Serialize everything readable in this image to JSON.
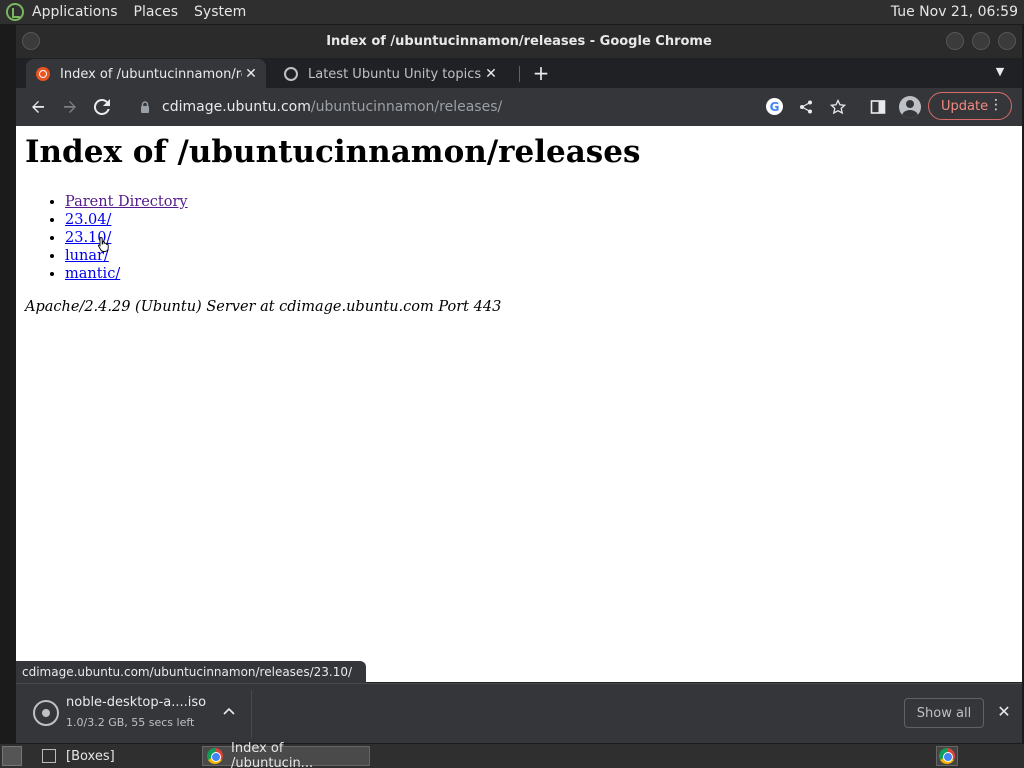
{
  "top_panel": {
    "menus": [
      "Applications",
      "Places",
      "System"
    ],
    "clock": "Tue Nov 21, 06:59"
  },
  "window": {
    "title": "Index of /ubuntucinnamon/releases - Google Chrome"
  },
  "tabs": [
    {
      "title": "Index of /ubuntucinnamon/releases",
      "active": true,
      "favicon": "ubuntu-icon"
    },
    {
      "title": "Latest Ubuntu Unity topics - Ubuntu Community Hub",
      "active": false,
      "favicon": "globe-icon"
    }
  ],
  "toolbar": {
    "url_host": "cdimage.ubuntu.com",
    "url_path": "/ubuntucinnamon/releases/",
    "update_label": "Update"
  },
  "page": {
    "heading": "Index of /ubuntucinnamon/releases",
    "links": [
      "Parent Directory",
      "23.04/",
      "23.10/",
      "lunar/",
      "mantic/"
    ],
    "server_signature": "Apache/2.4.29 (Ubuntu) Server at cdimage.ubuntu.com Port 443"
  },
  "status_bar": {
    "hover_url": "cdimage.ubuntu.com/ubuntucinnamon/releases/23.10/"
  },
  "download": {
    "filename": "noble-desktop-a....iso",
    "status": "1.0/3.2 GB, 55 secs left",
    "show_all": "Show all"
  },
  "taskbar": {
    "items": [
      "[Boxes]",
      "Index of /ubuntucin..."
    ]
  }
}
